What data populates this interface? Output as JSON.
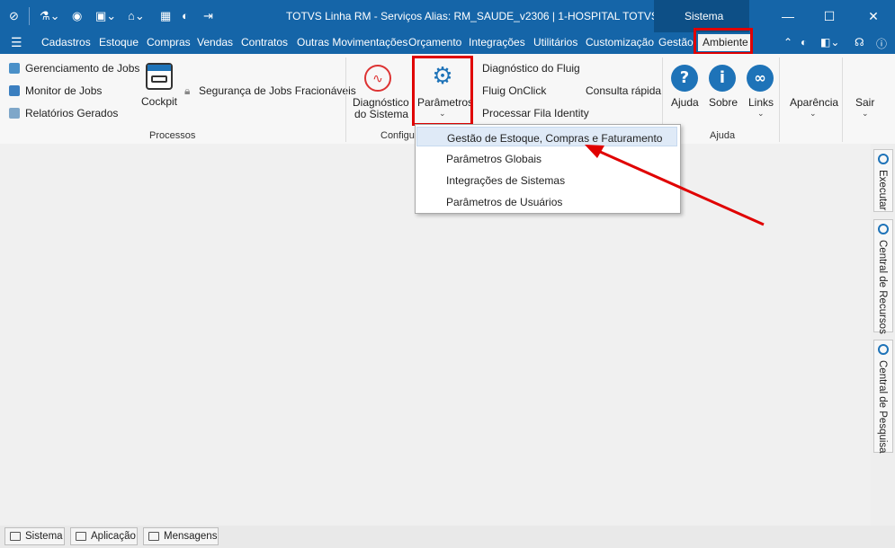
{
  "window": {
    "title": "TOTVS Linha RM - Serviços  Alias: RM_SAUDE_v2306 | 1-HOSPITAL TOTVS",
    "system_tab": "Sistema",
    "minimize_glyph": "—",
    "maximize_glyph": "☐",
    "close_glyph": "✕"
  },
  "menu": {
    "items": [
      "Cadastros",
      "Estoque",
      "Compras",
      "Vendas",
      "Contratos",
      "Outras Movimentações",
      "Orçamento",
      "Integrações",
      "Utilitários",
      "Customização",
      "Gestão",
      "Ambiente"
    ]
  },
  "ribbon": {
    "processos": {
      "label": "Processos",
      "items": [
        "Gerenciamento de Jobs",
        "Monitor de Jobs",
        "Relatórios Gerados"
      ],
      "cockpit": "Cockpit",
      "seguranca": "Segurança de Jobs Fracionáveis"
    },
    "config": {
      "label": "Configu",
      "diagnostico_line1": "Diagnóstico",
      "diagnostico_line2": "do Sistema",
      "parametros": "Parâmetros",
      "small_items": [
        "Diagnóstico do Fluig",
        "Fluig OnClick",
        "Processar Fila Identity"
      ],
      "consulta": "Consulta rápida"
    },
    "ajuda": {
      "label": "Ajuda",
      "ajuda": "Ajuda",
      "sobre": "Sobre",
      "links": "Links"
    },
    "aparencia": "Aparência",
    "sair": "Sair"
  },
  "dropdown": {
    "items": [
      "Gestão de Estoque, Compras e Faturamento",
      "Parâmetros Globais",
      "Integrações de Sistemas",
      "Parâmetros de Usuários"
    ]
  },
  "side_tabs": [
    "Executar",
    "Central de Recursos",
    "Central de Pesquisa"
  ],
  "bottom_tabs": [
    "Sistema",
    "Aplicação",
    "Mensagens"
  ],
  "colors": {
    "header_blue": "#1565a8",
    "highlight_red": "#e00000",
    "icon_blue": "#1e73b8"
  }
}
